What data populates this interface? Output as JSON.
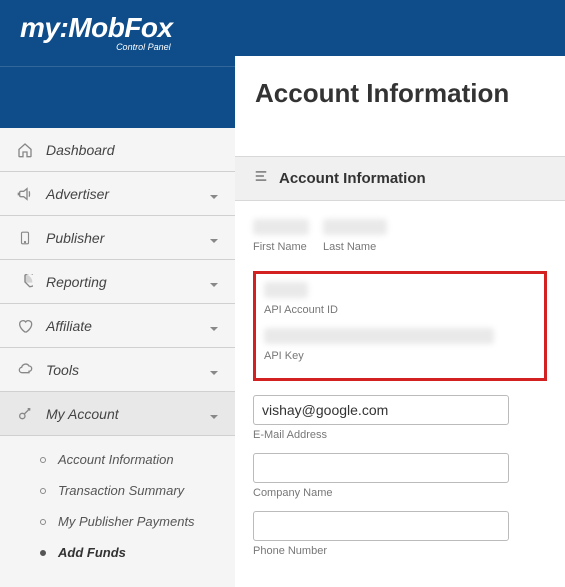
{
  "brand": {
    "name": "my:MobFox",
    "tagline": "Control Panel"
  },
  "page": {
    "title": "Account Information"
  },
  "sidebar": {
    "items": [
      {
        "label": "Dashboard"
      },
      {
        "label": "Advertiser"
      },
      {
        "label": "Publisher"
      },
      {
        "label": "Reporting"
      },
      {
        "label": "Affiliate"
      },
      {
        "label": "Tools"
      },
      {
        "label": "My Account"
      }
    ],
    "sub": [
      {
        "label": "Account Information"
      },
      {
        "label": "Transaction Summary"
      },
      {
        "label": "My Publisher Payments"
      },
      {
        "label": "Add Funds"
      }
    ]
  },
  "panel": {
    "title": "Account Information"
  },
  "form": {
    "first_name_label": "First Name",
    "last_name_label": "Last Name",
    "api_account_id_label": "API Account ID",
    "api_key_label": "API Key",
    "email_label": "E-Mail Address",
    "email_value": "vishay@google.com",
    "company_label": "Company Name",
    "company_value": "",
    "phone_label": "Phone Number",
    "phone_value": ""
  }
}
